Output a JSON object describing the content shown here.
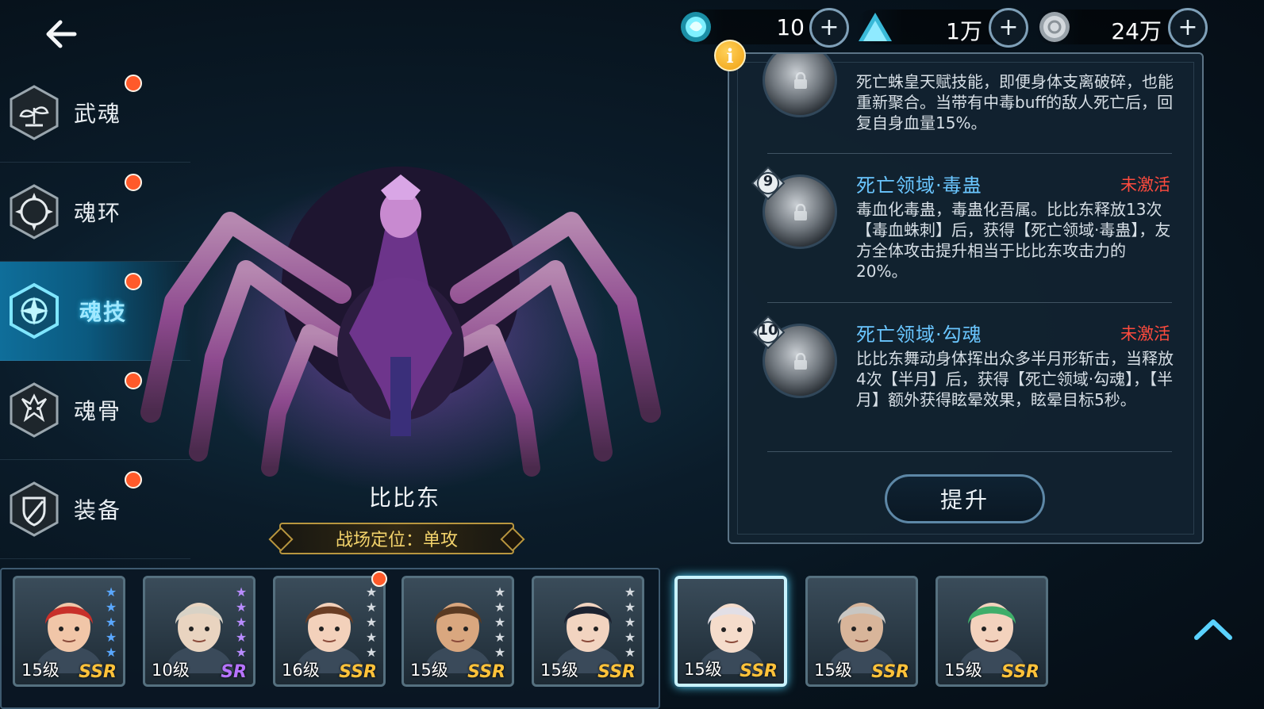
{
  "header": {
    "back_label": "",
    "currencies": [
      {
        "icon": "soul-crystal-icon",
        "value": "10"
      },
      {
        "icon": "blue-gem-pile-icon",
        "value": "1万"
      },
      {
        "icon": "silver-coin-icon",
        "value": "24万"
      }
    ]
  },
  "menu": {
    "items": [
      {
        "label": "武魂",
        "icon": "martial-soul-icon",
        "active": false
      },
      {
        "label": "魂环",
        "icon": "soul-ring-icon",
        "active": false
      },
      {
        "label": "魂技",
        "icon": "soul-skill-icon",
        "active": true
      },
      {
        "label": "魂骨",
        "icon": "soul-bone-icon",
        "active": false
      },
      {
        "label": "装备",
        "icon": "equipment-icon",
        "active": false
      }
    ]
  },
  "character": {
    "name": "比比东",
    "role": "战场定位：单攻"
  },
  "skills": [
    {
      "title": "",
      "level": "",
      "status": "",
      "desc": "死亡蛛皇天赋技能，即便身体支离破碎，也能重新聚合。当带有中毒buff的敌人死亡后，回复自身血量15%。"
    },
    {
      "title": "死亡领域·毒蛊",
      "level": "9",
      "status": "未激活",
      "desc": "毒血化毒蛊，毒蛊化吾属。比比东释放13次【毒血蛛刺】后，获得【死亡领域·毒蛊】，友方全体攻击提升相当于比比东攻击力的20%。"
    },
    {
      "title": "死亡领域·勾魂",
      "level": "10",
      "status": "未激活",
      "desc": "比比东舞动身体挥出众多半月形斩击，当释放4次【半月】后，获得【死亡领域·勾魂】，【半月】额外获得眩晕效果，眩晕目标5秒。"
    }
  ],
  "upgrade_label": "提升",
  "roster": [
    {
      "level": "15级",
      "rarity": "SSR",
      "stars": 5,
      "star_color": "#5aa8ff"
    },
    {
      "level": "10级",
      "rarity": "SR",
      "stars": 5,
      "star_color": "#b88cff"
    },
    {
      "level": "16级",
      "rarity": "SSR",
      "stars": 5,
      "star_color": "#d6dbe0"
    },
    {
      "level": "15级",
      "rarity": "SSR",
      "stars": 5,
      "star_color": "#d6dbe0"
    },
    {
      "level": "15级",
      "rarity": "SSR",
      "stars": 5,
      "star_color": "#d6dbe0"
    },
    {
      "level": "15级",
      "rarity": "SSR",
      "stars": 0,
      "star_color": "#d6dbe0"
    },
    {
      "level": "15级",
      "rarity": "SSR",
      "stars": 0,
      "star_color": "#d6dbe0"
    },
    {
      "level": "15级",
      "rarity": "SSR",
      "stars": 0,
      "star_color": "#d6dbe0"
    }
  ]
}
